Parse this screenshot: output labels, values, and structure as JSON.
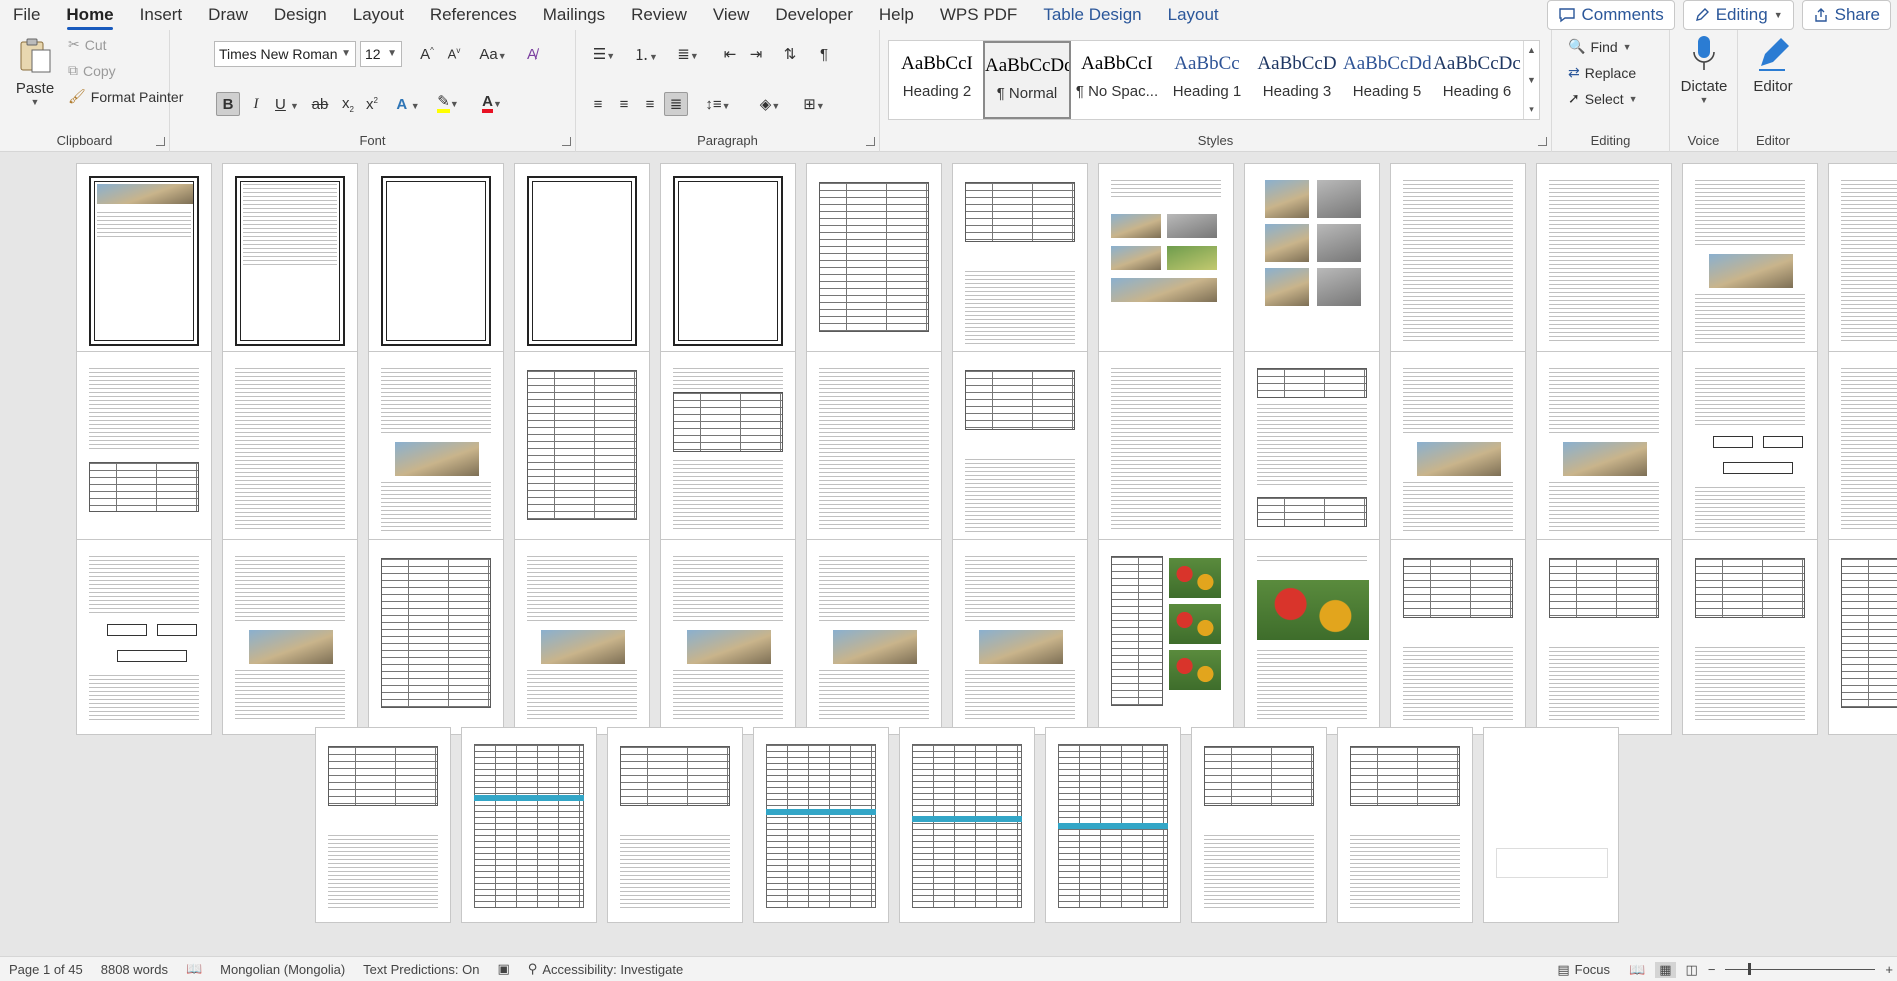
{
  "menu": {
    "tabs": [
      {
        "label": "File",
        "active": false,
        "contextual": false
      },
      {
        "label": "Home",
        "active": true,
        "contextual": false
      },
      {
        "label": "Insert",
        "active": false,
        "contextual": false
      },
      {
        "label": "Draw",
        "active": false,
        "contextual": false
      },
      {
        "label": "Design",
        "active": false,
        "contextual": false
      },
      {
        "label": "Layout",
        "active": false,
        "contextual": false
      },
      {
        "label": "References",
        "active": false,
        "contextual": false
      },
      {
        "label": "Mailings",
        "active": false,
        "contextual": false
      },
      {
        "label": "Review",
        "active": false,
        "contextual": false
      },
      {
        "label": "View",
        "active": false,
        "contextual": false
      },
      {
        "label": "Developer",
        "active": false,
        "contextual": false
      },
      {
        "label": "Help",
        "active": false,
        "contextual": false
      },
      {
        "label": "WPS PDF",
        "active": false,
        "contextual": false
      },
      {
        "label": "Table Design",
        "active": false,
        "contextual": true
      },
      {
        "label": "Layout",
        "active": false,
        "contextual": true
      }
    ],
    "comments_label": "Comments",
    "editing_label": "Editing",
    "share_label": "Share"
  },
  "ribbon": {
    "clipboard": {
      "label": "Clipboard",
      "paste": "Paste",
      "cut": "Cut",
      "copy": "Copy",
      "format_painter": "Format Painter"
    },
    "font": {
      "label": "Font",
      "font_name": "Times New Roman",
      "font_size": "12"
    },
    "paragraph": {
      "label": "Paragraph"
    },
    "styles": {
      "label": "Styles",
      "items": [
        {
          "preview": "AaBbCcI",
          "name": "Heading 2",
          "color": "#000000",
          "selected": false
        },
        {
          "preview": "AaBbCcDd",
          "name": "¶ Normal",
          "color": "#000000",
          "selected": true
        },
        {
          "preview": "AaBbCcI",
          "name": "¶ No Spac...",
          "color": "#000000",
          "selected": false
        },
        {
          "preview": "AaBbCc",
          "name": "Heading 1",
          "color": "#2f5496",
          "selected": false
        },
        {
          "preview": "AaBbCcD",
          "name": "Heading 3",
          "color": "#1f3763",
          "selected": false
        },
        {
          "preview": "AaBbCcDd",
          "name": "Heading 5",
          "color": "#2f5496",
          "selected": false
        },
        {
          "preview": "AaBbCcDc",
          "name": "Heading 6",
          "color": "#1f3763",
          "selected": false
        }
      ]
    },
    "editing": {
      "label": "Editing",
      "find": "Find",
      "replace": "Replace",
      "select": "Select"
    },
    "voice": {
      "label": "Voice",
      "dictate": "Dictate"
    },
    "editor": {
      "label": "Editor",
      "editor": "Editor"
    }
  },
  "status": {
    "page": "Page 1 of 45",
    "words": "8808 words",
    "language": "Mongolian (Mongolia)",
    "text_predictions": "Text Predictions: On",
    "accessibility": "Accessibility: Investigate",
    "focus": "Focus",
    "zoom_fraction": 0.15
  },
  "colors": {
    "accent": "#185abd",
    "contextual_tab": "#2b579a",
    "highlight_yellow": "#ffff00",
    "font_color_red": "#e81123",
    "table_cyan": "#33a6c7"
  }
}
